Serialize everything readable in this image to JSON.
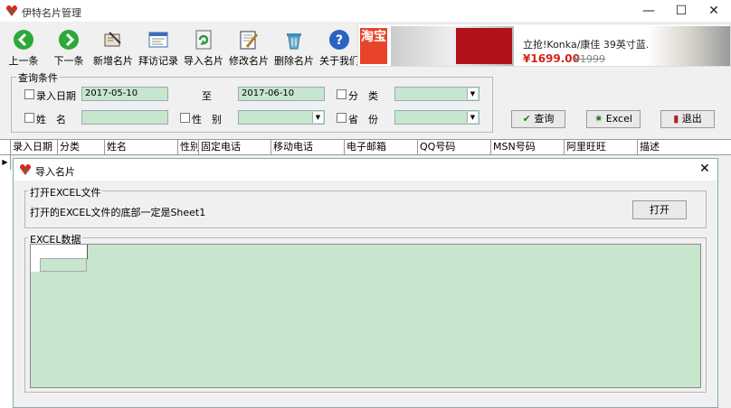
{
  "window": {
    "title": "伊特名片管理"
  },
  "toolbar": {
    "items": [
      {
        "label": "上一条",
        "icon": "arrow-left-icon"
      },
      {
        "label": "下一条",
        "icon": "arrow-right-icon"
      },
      {
        "label": "新增名片",
        "icon": "new-card-icon"
      },
      {
        "label": "拜访记录",
        "icon": "visit-record-icon"
      },
      {
        "label": "导入名片",
        "icon": "import-icon"
      },
      {
        "label": "修改名片",
        "icon": "edit-icon"
      },
      {
        "label": "删除名片",
        "icon": "delete-icon"
      },
      {
        "label": "关于我们",
        "icon": "help-icon"
      }
    ]
  },
  "ad": {
    "brand": "淘宝",
    "text": "立抢!Konka/康佳 39英寸蓝...",
    "price": "¥1699.00",
    "old_price": "¥1999"
  },
  "query": {
    "legend": "查询条件",
    "entry_date_label": "录入日期",
    "date_from": "2017-05-10",
    "to_label": "至",
    "date_to": "2017-06-10",
    "category_label": "分　类",
    "name_label": "姓　名",
    "gender_label": "性　别",
    "province_label": "省　份",
    "search_button": "查询",
    "excel_button": "Excel",
    "exit_button": "退出"
  },
  "grid": {
    "columns": [
      "录入日期",
      "分类",
      "姓名",
      "性别",
      "固定电话",
      "移动电话",
      "电子邮箱",
      "QQ号码",
      "MSN号码",
      "阿里旺旺",
      "描述"
    ]
  },
  "dialog": {
    "title": "导入名片",
    "open_group_legend": "打开EXCEL文件",
    "open_hint": "打开的EXCEL文件的底部一定是Sheet1",
    "open_button": "打开",
    "data_group_legend": "EXCEL数据"
  }
}
